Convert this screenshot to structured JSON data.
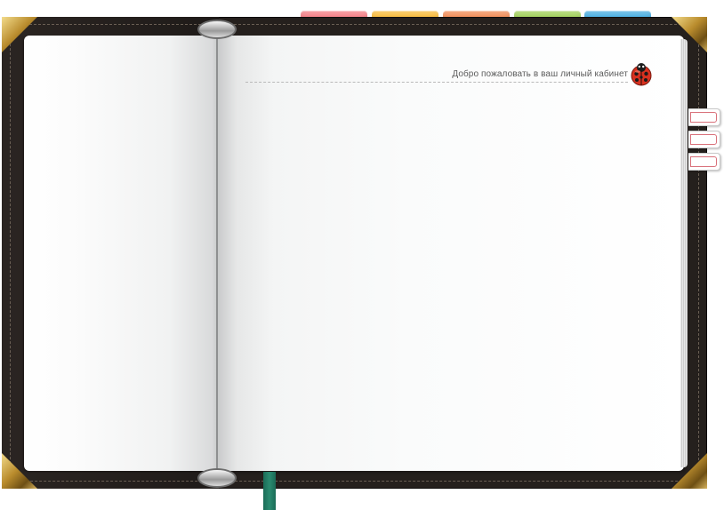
{
  "header": {
    "greeting": "Добро пожаловать в ваш личный кабинет"
  },
  "icons": {
    "mascot": "ladybug-icon"
  },
  "top_tabs": [
    {
      "color": "#f2737b"
    },
    {
      "color": "#f7b52c"
    },
    {
      "color": "#f08349"
    },
    {
      "color": "#99cc4c"
    },
    {
      "color": "#3aa7df"
    }
  ],
  "colors": {
    "cover": "#25201d",
    "page": "#fafbfa",
    "ribbon": "#1f7a62",
    "side_tab_border": "#d9707a",
    "corner_brass": "#b98c2d"
  }
}
